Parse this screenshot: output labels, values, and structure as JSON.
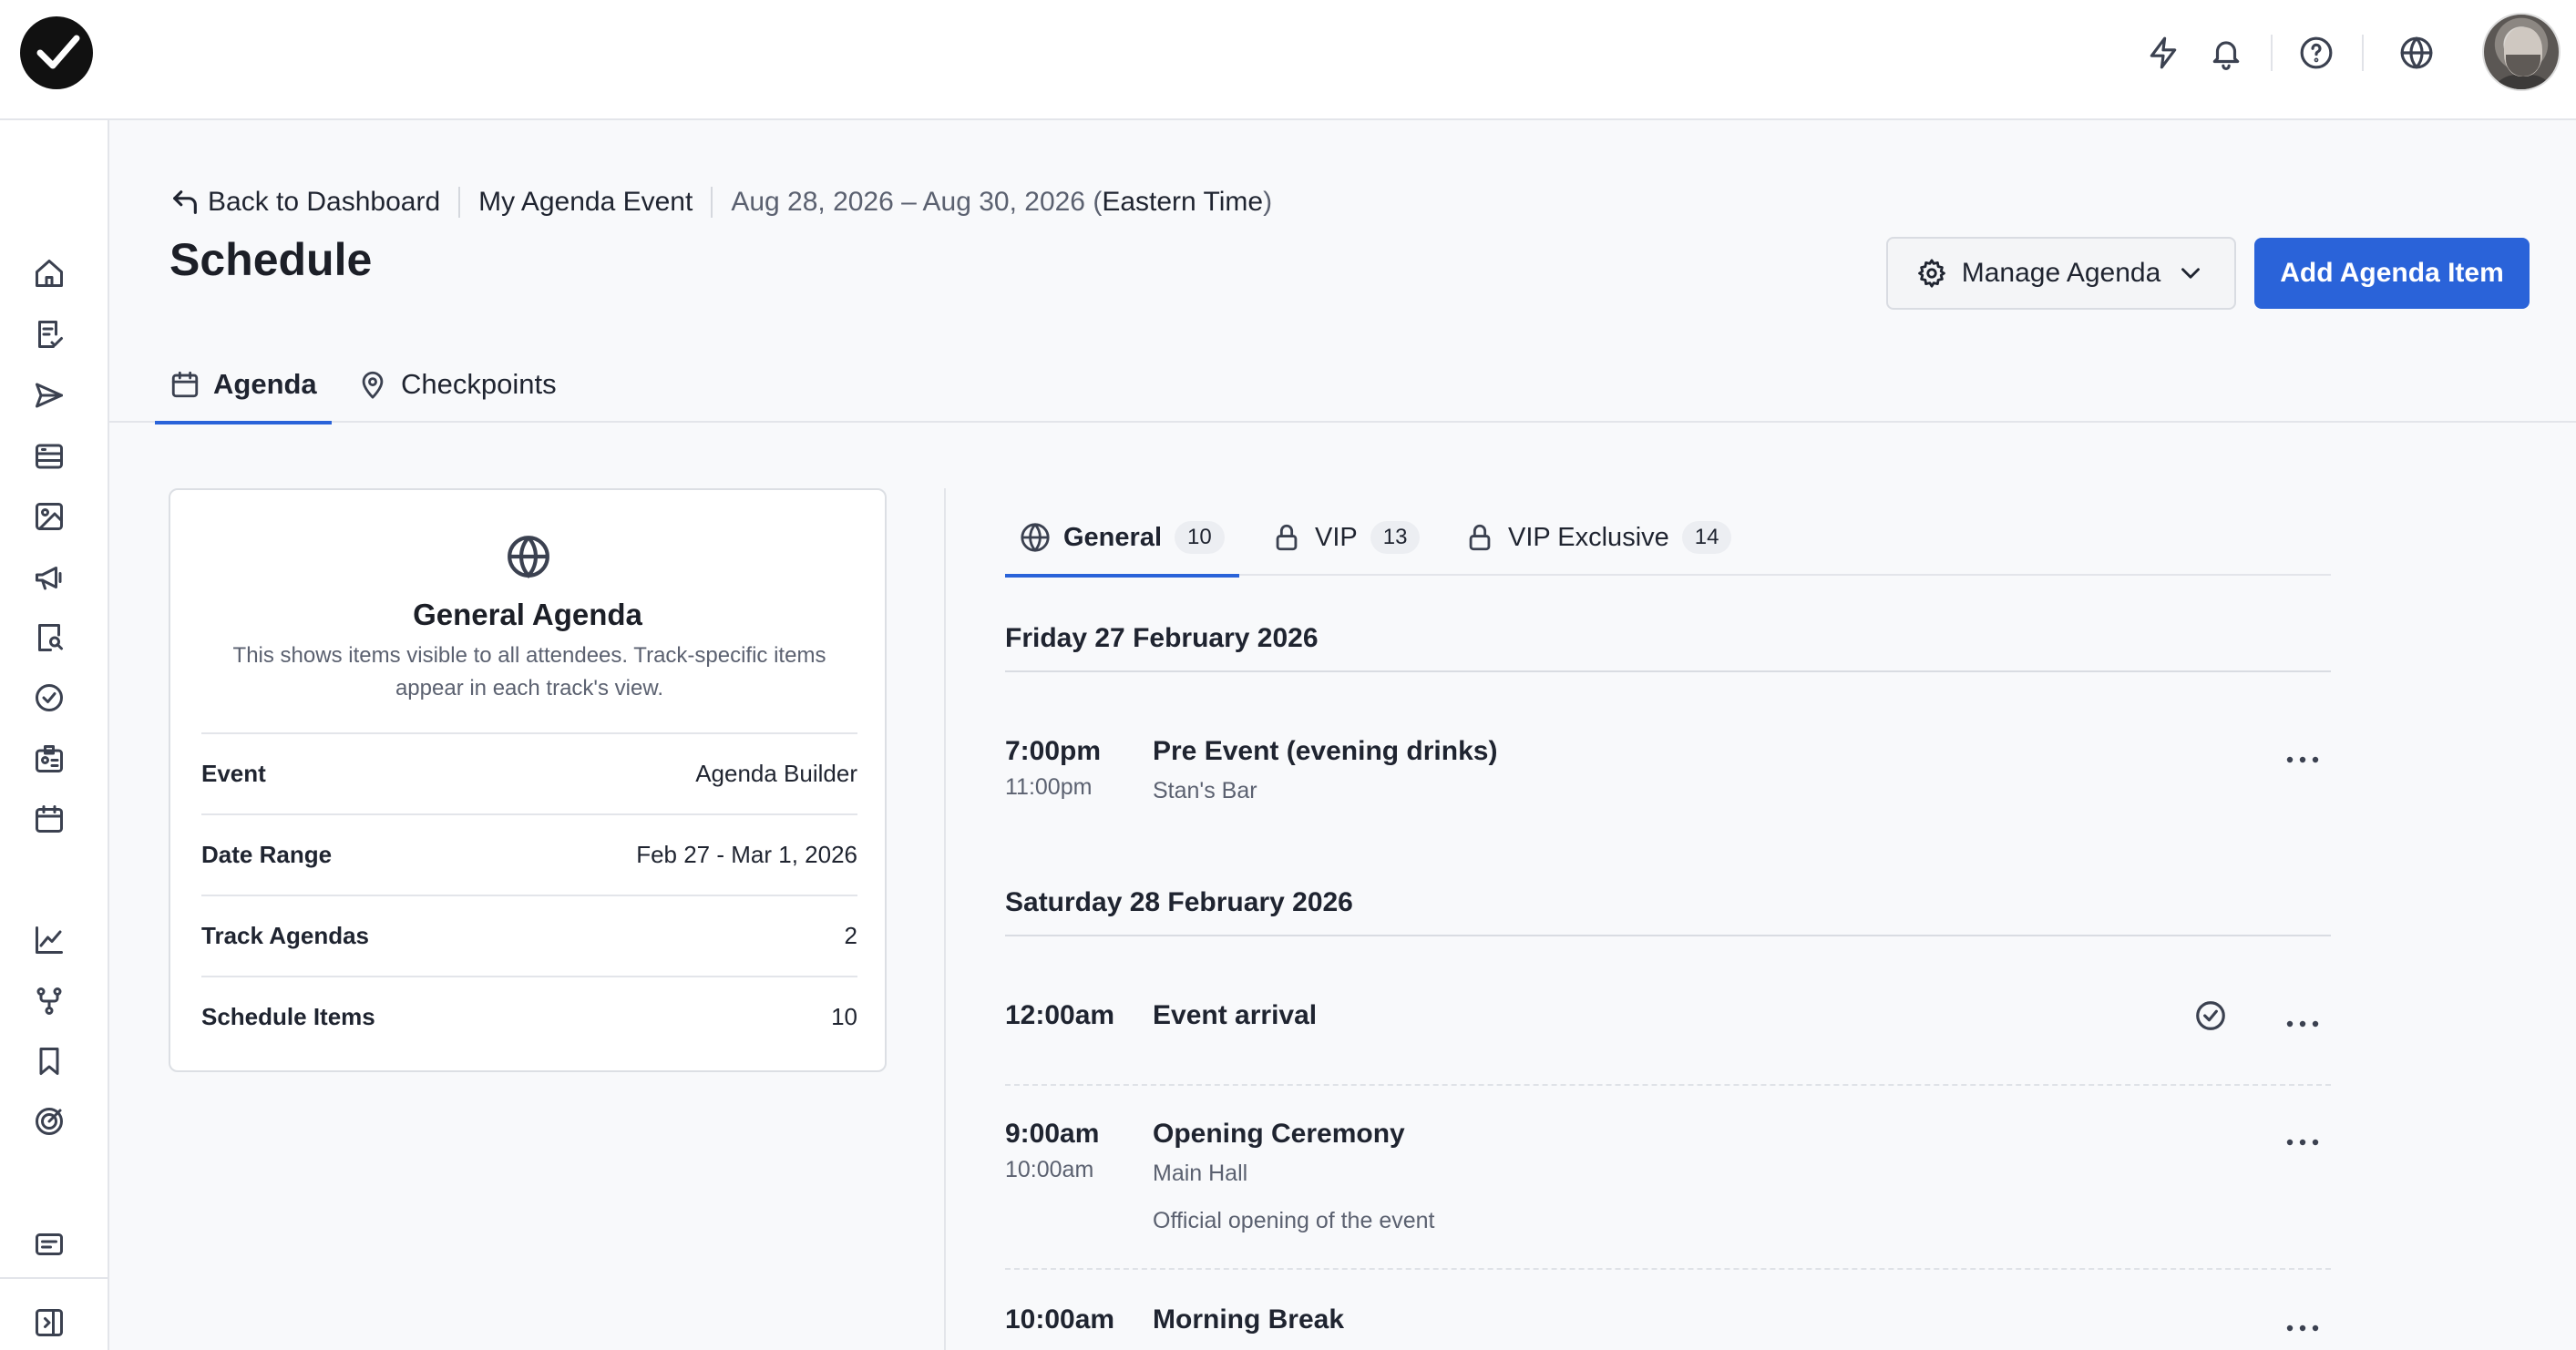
{
  "header": {
    "icons": [
      "logo-icon",
      "lightning-icon",
      "bell-icon",
      "help-icon",
      "globe-icon",
      "avatar"
    ]
  },
  "sidebar": {
    "icons": [
      "home-icon",
      "checklist-icon",
      "send-icon",
      "list-icon",
      "image-icon",
      "megaphone-icon",
      "badge-search-icon",
      "check-badge-icon",
      "id-card-icon",
      "calendar-icon",
      "chart-icon",
      "branch-icon",
      "bookmark-icon",
      "target-icon",
      "message-icon",
      "panel-toggle-icon"
    ]
  },
  "breadcrumb": {
    "back": "Back to Dashboard",
    "event": "My Agenda Event",
    "dates": "Aug 28, 2026 – Aug 30, 2026 (",
    "timezone": "Eastern Time",
    "close_paren": ")"
  },
  "page": {
    "title": "Schedule",
    "manage_label": "Manage Agenda",
    "add_label": "Add Agenda Item"
  },
  "tabs": [
    {
      "label": "Agenda",
      "icon": "calendar-icon",
      "active": true
    },
    {
      "label": "Checkpoints",
      "icon": "map-pin-icon",
      "active": false
    }
  ],
  "card": {
    "title": "General Agenda",
    "description": "This shows items visible to all attendees. Track-specific items appear in each track's view.",
    "rows": [
      {
        "label": "Event",
        "value": "Agenda Builder"
      },
      {
        "label": "Date Range",
        "value": "Feb 27 - Mar 1, 2026"
      },
      {
        "label": "Track Agendas",
        "value": "2"
      },
      {
        "label": "Schedule Items",
        "value": "10"
      }
    ]
  },
  "track_tabs": [
    {
      "label": "General",
      "count": "10",
      "icon": "globe-icon",
      "active": true
    },
    {
      "label": "VIP",
      "count": "13",
      "icon": "lock-icon",
      "active": false
    },
    {
      "label": "VIP Exclusive",
      "count": "14",
      "icon": "lock-icon",
      "active": false
    }
  ],
  "days": [
    {
      "heading": "Friday 27 February 2026",
      "items": [
        {
          "start": "7:00pm",
          "end": "11:00pm",
          "title": "Pre Event (evening drinks)",
          "location": "Stan's Bar"
        }
      ]
    },
    {
      "heading": "Saturday 28 February 2026",
      "items": [
        {
          "start": "12:00am",
          "title": "Event arrival",
          "checked": true
        },
        {
          "start": "9:00am",
          "end": "10:00am",
          "title": "Opening Ceremony",
          "location": "Main Hall",
          "description": "Official opening of the event"
        },
        {
          "start": "10:00am",
          "title": "Morning Break"
        }
      ]
    }
  ],
  "colors": {
    "accent": "#2a63d9",
    "border": "#e3e5ea",
    "muted_text": "#5b6170"
  }
}
